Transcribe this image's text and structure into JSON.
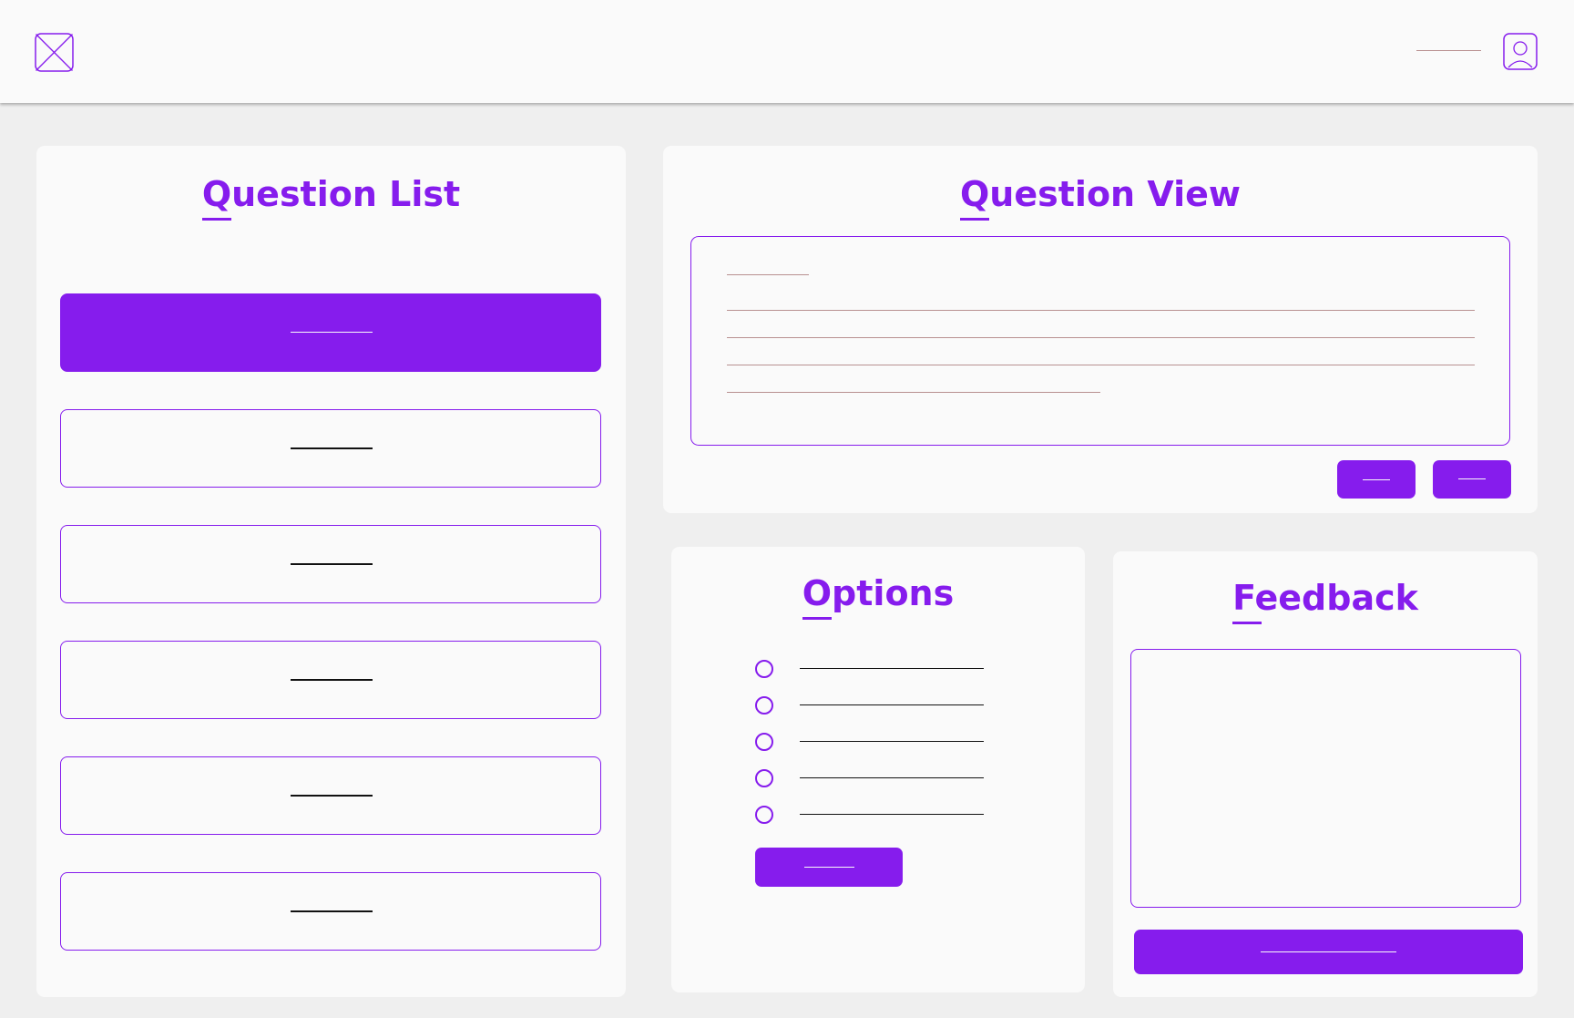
{
  "header": {
    "logo_icon": "image-placeholder-icon",
    "avatar_icon": "user-avatar-icon"
  },
  "question_list": {
    "title": "Question List",
    "items": [
      "",
      "",
      "",
      "",
      "",
      ""
    ],
    "active_index": 0
  },
  "question_view": {
    "title": "Question View"
  },
  "options": {
    "title": "Options",
    "choices": [
      "",
      "",
      "",
      "",
      ""
    ]
  },
  "feedback": {
    "title": "Feedback"
  },
  "colors": {
    "accent": "#861ced",
    "panel": "#fafafa",
    "background": "#efefef",
    "text_line": "#b89090"
  }
}
